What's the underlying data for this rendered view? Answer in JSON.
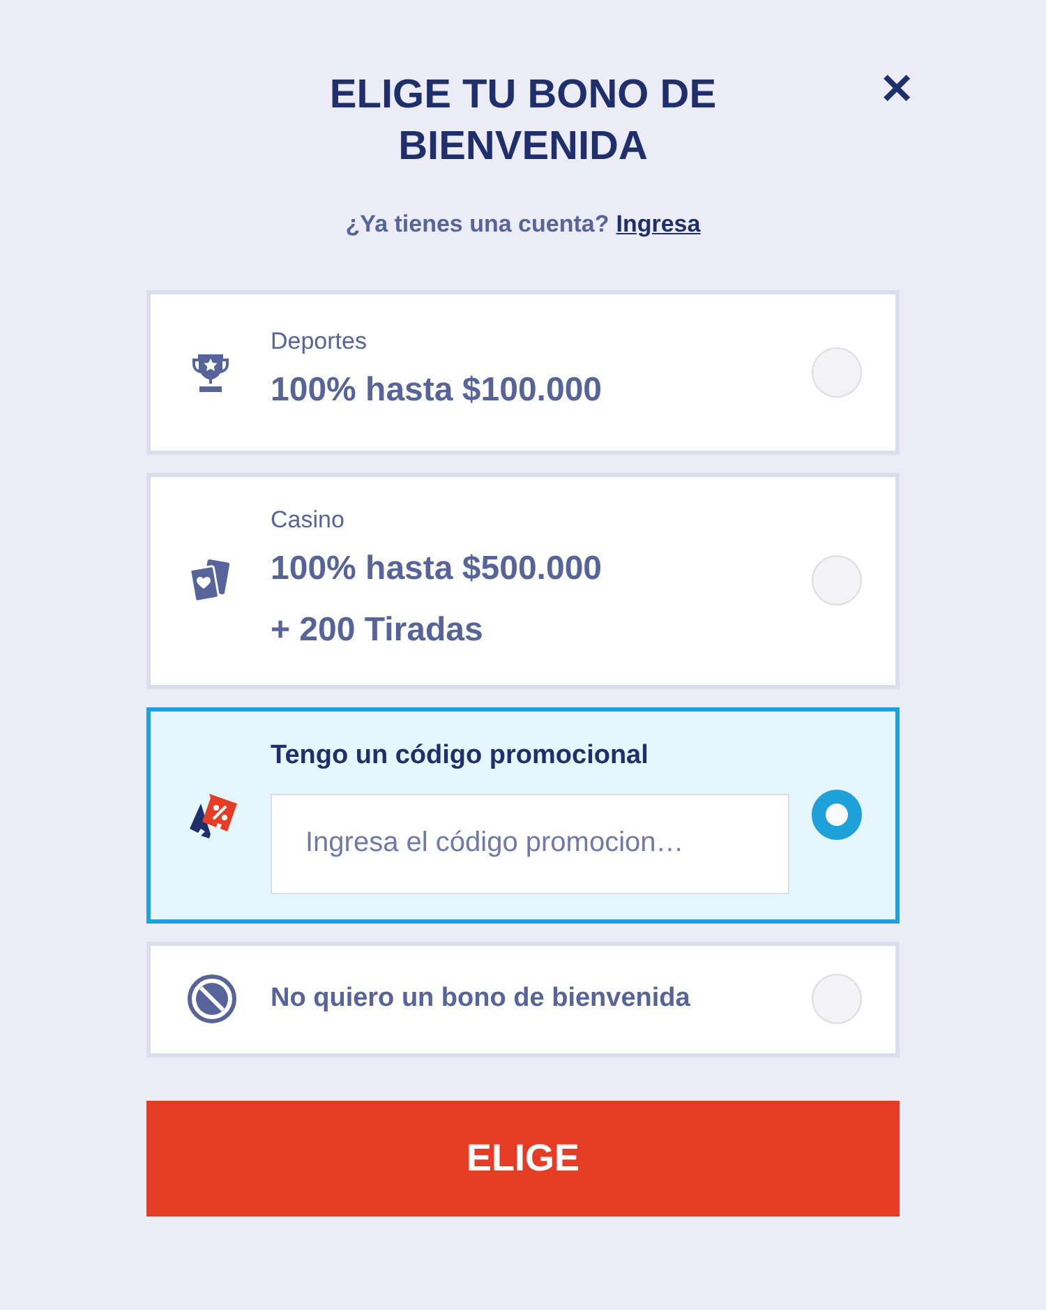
{
  "title": "ELIGE TU BONO DE BIENVENIDA",
  "close": {
    "label": "✕"
  },
  "login_prompt": {
    "text": "¿Ya tienes una cuenta?",
    "link": "Ingresa"
  },
  "options": [
    {
      "kind": "sports",
      "label": "Deportes",
      "lines": [
        "100% hasta $100.000"
      ],
      "selected": false
    },
    {
      "kind": "casino",
      "label": "Casino",
      "lines": [
        "100% hasta $500.000",
        "+ 200 Tiradas"
      ],
      "selected": false
    },
    {
      "kind": "promo",
      "label": "Tengo un código promocional",
      "placeholder": "Ingresa el código promocion…",
      "selected": true
    },
    {
      "kind": "none",
      "label": "No quiero un bono de bienvenida",
      "selected": false
    }
  ],
  "submit": "ELIGE"
}
